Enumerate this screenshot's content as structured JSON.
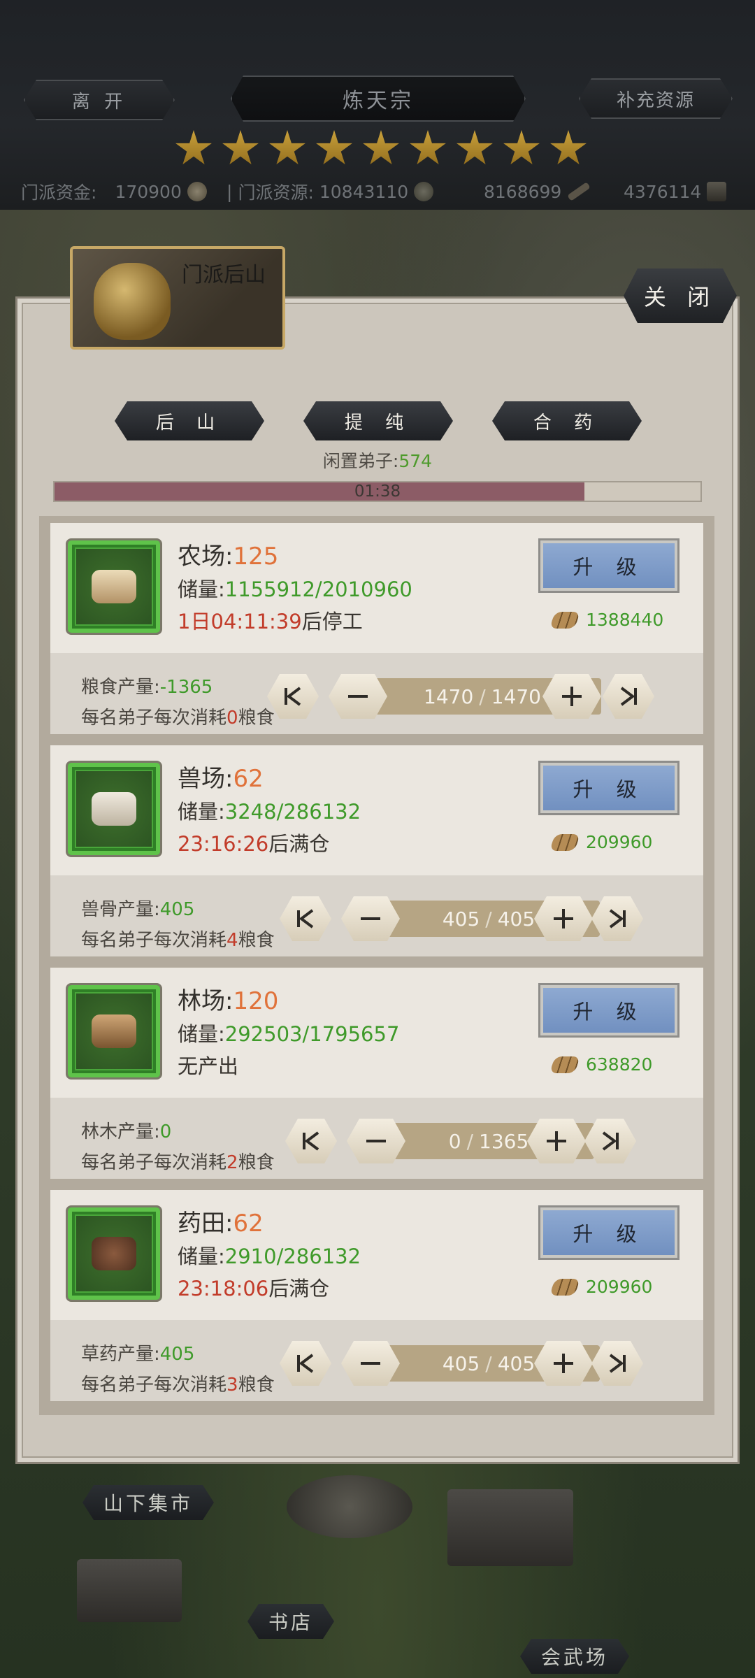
{
  "header": {
    "leave_label": "离 开",
    "title": "炼天宗",
    "replenish_label": "补充资源",
    "star_count": 9,
    "funds_label": "门派资金:",
    "funds_value": "170900",
    "separator": "|",
    "resources_label": "门派资源:",
    "resources_value": "10843110",
    "res2_value": "8168699",
    "res3_value": "4376114"
  },
  "panel": {
    "title": "门派后山",
    "close_label": "关 闭",
    "tabs": [
      {
        "label": "后 山"
      },
      {
        "label": "提 纯"
      },
      {
        "label": "合 药"
      }
    ],
    "idle_label": "闲置弟子:",
    "idle_value": "574",
    "timer": "01:38",
    "timer_progress": 0.82
  },
  "upgrade_label": "升 级",
  "facilities": [
    {
      "name": "农场:",
      "level": "125",
      "stock_label": "储量:",
      "stock": "1155912/2010960",
      "status_time": "1日04:11:39",
      "status_text": "后停工",
      "cost": "1388440",
      "prod_label": "粮食产量:",
      "prod_value": "-1365",
      "consume_pre": "每名弟子每次消耗",
      "consume_n": "0",
      "consume_post": "粮食",
      "current": "1470",
      "max": "1470"
    },
    {
      "name": "兽场:",
      "level": "62",
      "stock_label": "储量:",
      "stock": "3248/286132",
      "status_time": "23:16:26",
      "status_text": "后满仓",
      "cost": "209960",
      "prod_label": "兽骨产量:",
      "prod_value": "405",
      "consume_pre": "每名弟子每次消耗",
      "consume_n": "4",
      "consume_post": "粮食",
      "current": "405",
      "max": "405"
    },
    {
      "name": "林场:",
      "level": "120",
      "stock_label": "储量:",
      "stock": "292503/1795657",
      "status_time": "",
      "status_text": "无产出",
      "cost": "638820",
      "prod_label": "林木产量:",
      "prod_value": "0",
      "consume_pre": "每名弟子每次消耗",
      "consume_n": "2",
      "consume_post": "粮食",
      "current": "0",
      "max": "1365"
    },
    {
      "name": "药田:",
      "level": "62",
      "stock_label": "储量:",
      "stock": "2910/286132",
      "status_time": "23:18:06",
      "status_text": "后满仓",
      "cost": "209960",
      "prod_label": "草药产量:",
      "prod_value": "405",
      "consume_pre": "每名弟子每次消耗",
      "consume_n": "3",
      "consume_post": "粮食",
      "current": "405",
      "max": "405"
    }
  ],
  "stepper_icons": [
    "first-icon",
    "minus-icon",
    "plus-icon",
    "last-icon"
  ],
  "map": {
    "market_label": "山下集市",
    "bookstore_label": "书店",
    "arena_label": "会武场"
  }
}
